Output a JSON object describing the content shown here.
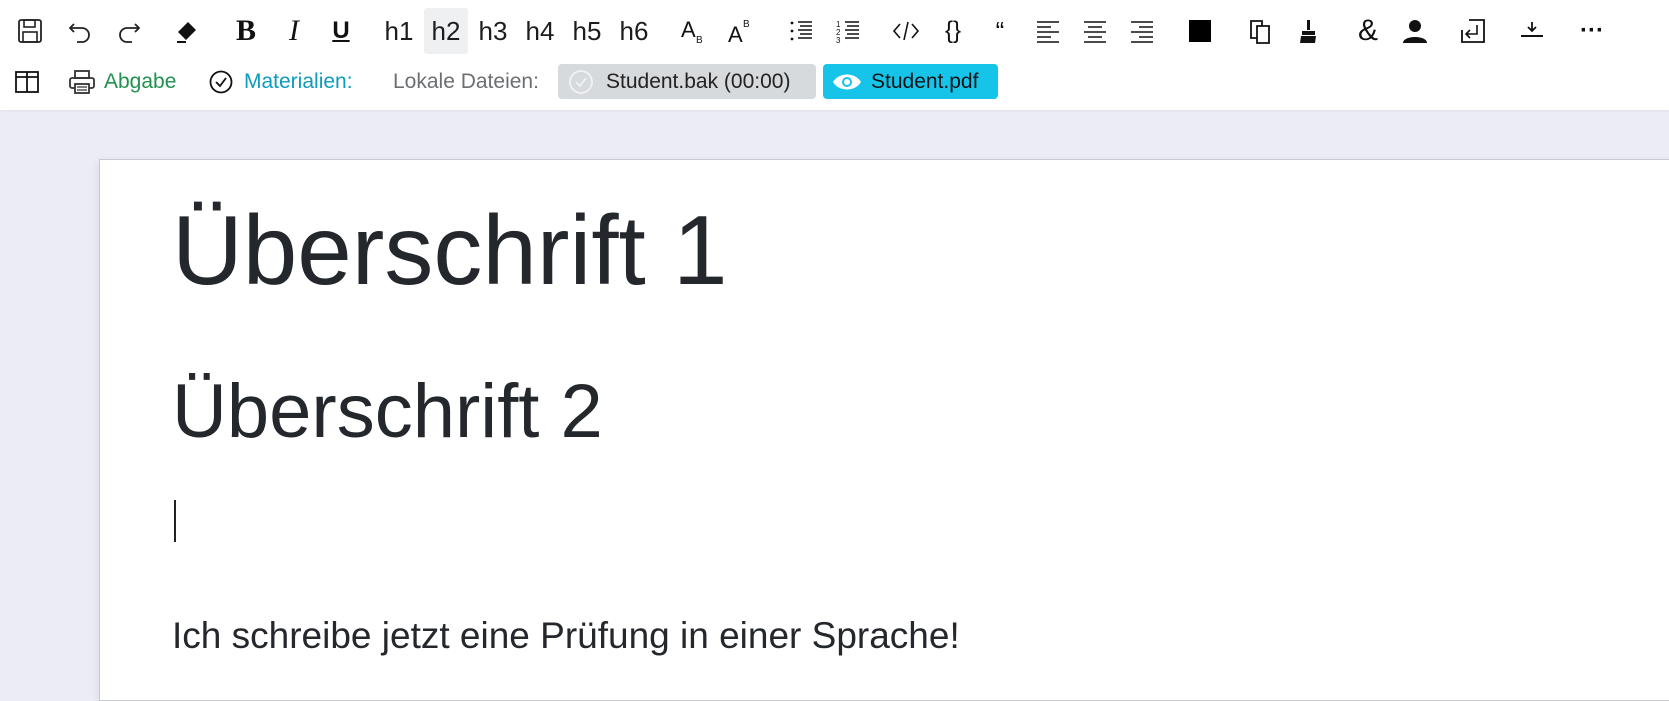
{
  "toolbar": {
    "headings": [
      "h1",
      "h2",
      "h3",
      "h4",
      "h5",
      "h6"
    ],
    "active_heading": "h2",
    "ampersand": "&",
    "more": "···",
    "quote": "“"
  },
  "bar": {
    "abgabe_label": "Abgabe",
    "materialien_label": "Materialien:",
    "lokale_label": "Lokale Dateien:",
    "files": [
      {
        "name": "Student.bak (00:00)"
      },
      {
        "name": "Student.pdf"
      }
    ]
  },
  "document": {
    "heading1": "Überschrift 1",
    "heading2": "Überschrift 2",
    "paragraph": "Ich schreibe jetzt eine Prüfung in einer Sprache!"
  },
  "colors": {
    "accent_green": "#22904e",
    "accent_teal": "#0e9bbf",
    "pdf_chip": "#16c4ea",
    "bak_chip": "#d7dadd"
  }
}
